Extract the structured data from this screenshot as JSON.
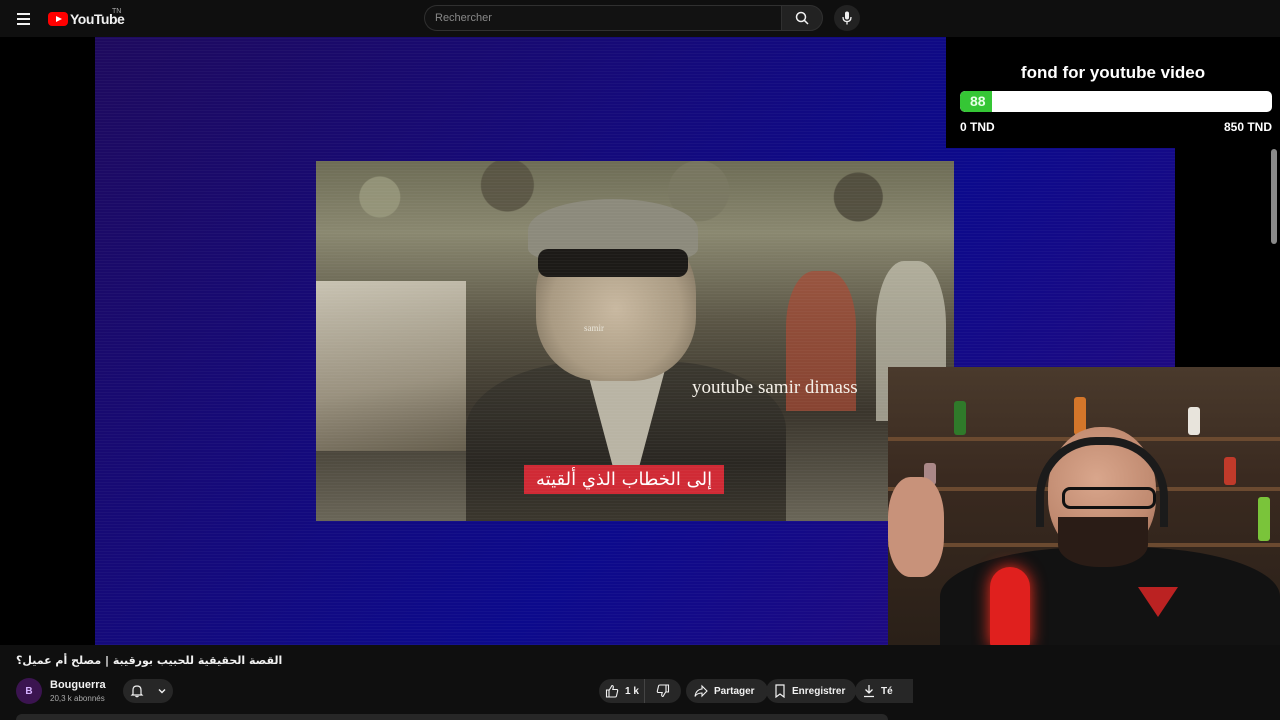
{
  "header": {
    "logo_text": "YouTube",
    "logo_region": "TN",
    "search_placeholder": "Rechercher"
  },
  "video": {
    "watermark_small": "samir",
    "watermark_large": "youtube samir dimass",
    "caption": "إلى الخطاب الذي ألقيته"
  },
  "fund": {
    "title": "fond for youtube video",
    "current": "88",
    "progress_fraction": 0.1035,
    "min_label": "0 TND",
    "max_label": "850 TND",
    "bar_color": "#35c635"
  },
  "info": {
    "title": "القصة الحقيقية للحبيب بورقيبة | مصلح أم عميل؟",
    "channel_name": "Bouguerra",
    "subscribers": "20,3 k abonnés",
    "avatar_letter": "B"
  },
  "actions": {
    "likes": "1 k",
    "share": "Partager",
    "save": "Enregistrer",
    "download": "Té"
  },
  "icons": {
    "menu": "menu-icon",
    "search": "search-icon",
    "mic": "mic-icon",
    "bell": "bell-icon",
    "chevron": "chevron-down-icon",
    "like": "thumb-up-icon",
    "dislike": "thumb-down-icon",
    "share": "share-icon",
    "save": "bookmark-icon",
    "download": "download-icon"
  },
  "colors": {
    "background": "#0f0f0f",
    "brand": "#ff0000",
    "caption_bg": "#d02a35"
  }
}
